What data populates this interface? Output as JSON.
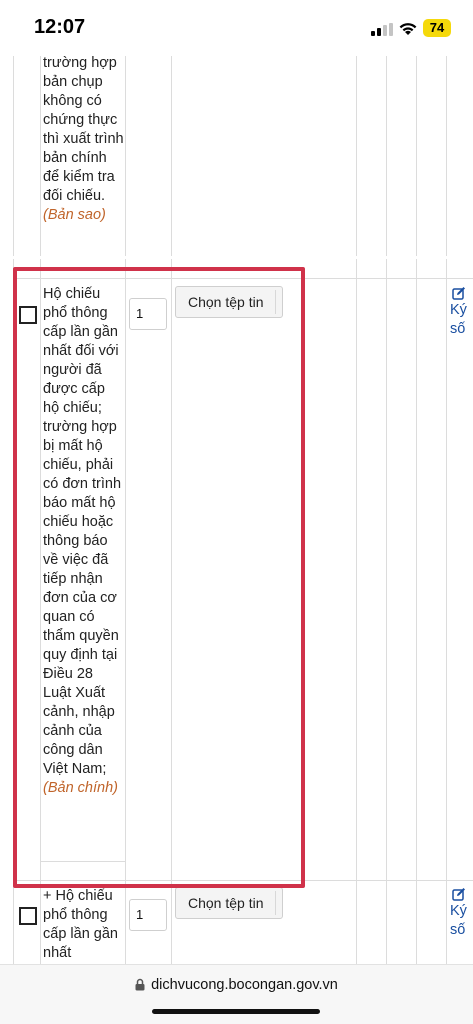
{
  "status_bar": {
    "time": "12:07",
    "battery": "74"
  },
  "rows": [
    {
      "description": "trường hợp bản chụp không có chứng thực thì xuất trình bản chính để kiểm tra đối chiếu.",
      "note": "(Bản sao)"
    },
    {
      "description": "Hộ chiếu phổ thông cấp lần gần nhất đối với người đã được cấp hộ chiếu; trường hợp bị mất hộ chiếu, phải có đơn trình báo mất hộ chiếu hoặc thông báo về việc đã tiếp nhận đơn của cơ quan có thẩm quyền quy định tại Điều 28 Luật Xuất cảnh, nhập cảnh của công dân Việt Nam;",
      "note": "(Bản chính)",
      "quantity": "1",
      "file_button": "Chọn tệp tin",
      "sign_label": "Ký số"
    },
    {
      "description": "+ Hộ chiếu phổ thông cấp lần gần nhất",
      "quantity": "1",
      "file_button": "Chọn tệp tin",
      "sign_label": "Ký số"
    }
  ],
  "url_bar": {
    "domain": "dichvucong.bocongan.gov.vn"
  },
  "icons": {
    "checkbox": "checkbox-icon",
    "sign": "edit-icon",
    "lock": "lock-icon"
  },
  "colors": {
    "highlight": "#d0324a",
    "note": "#c0642a",
    "link": "#1a4fa0"
  }
}
